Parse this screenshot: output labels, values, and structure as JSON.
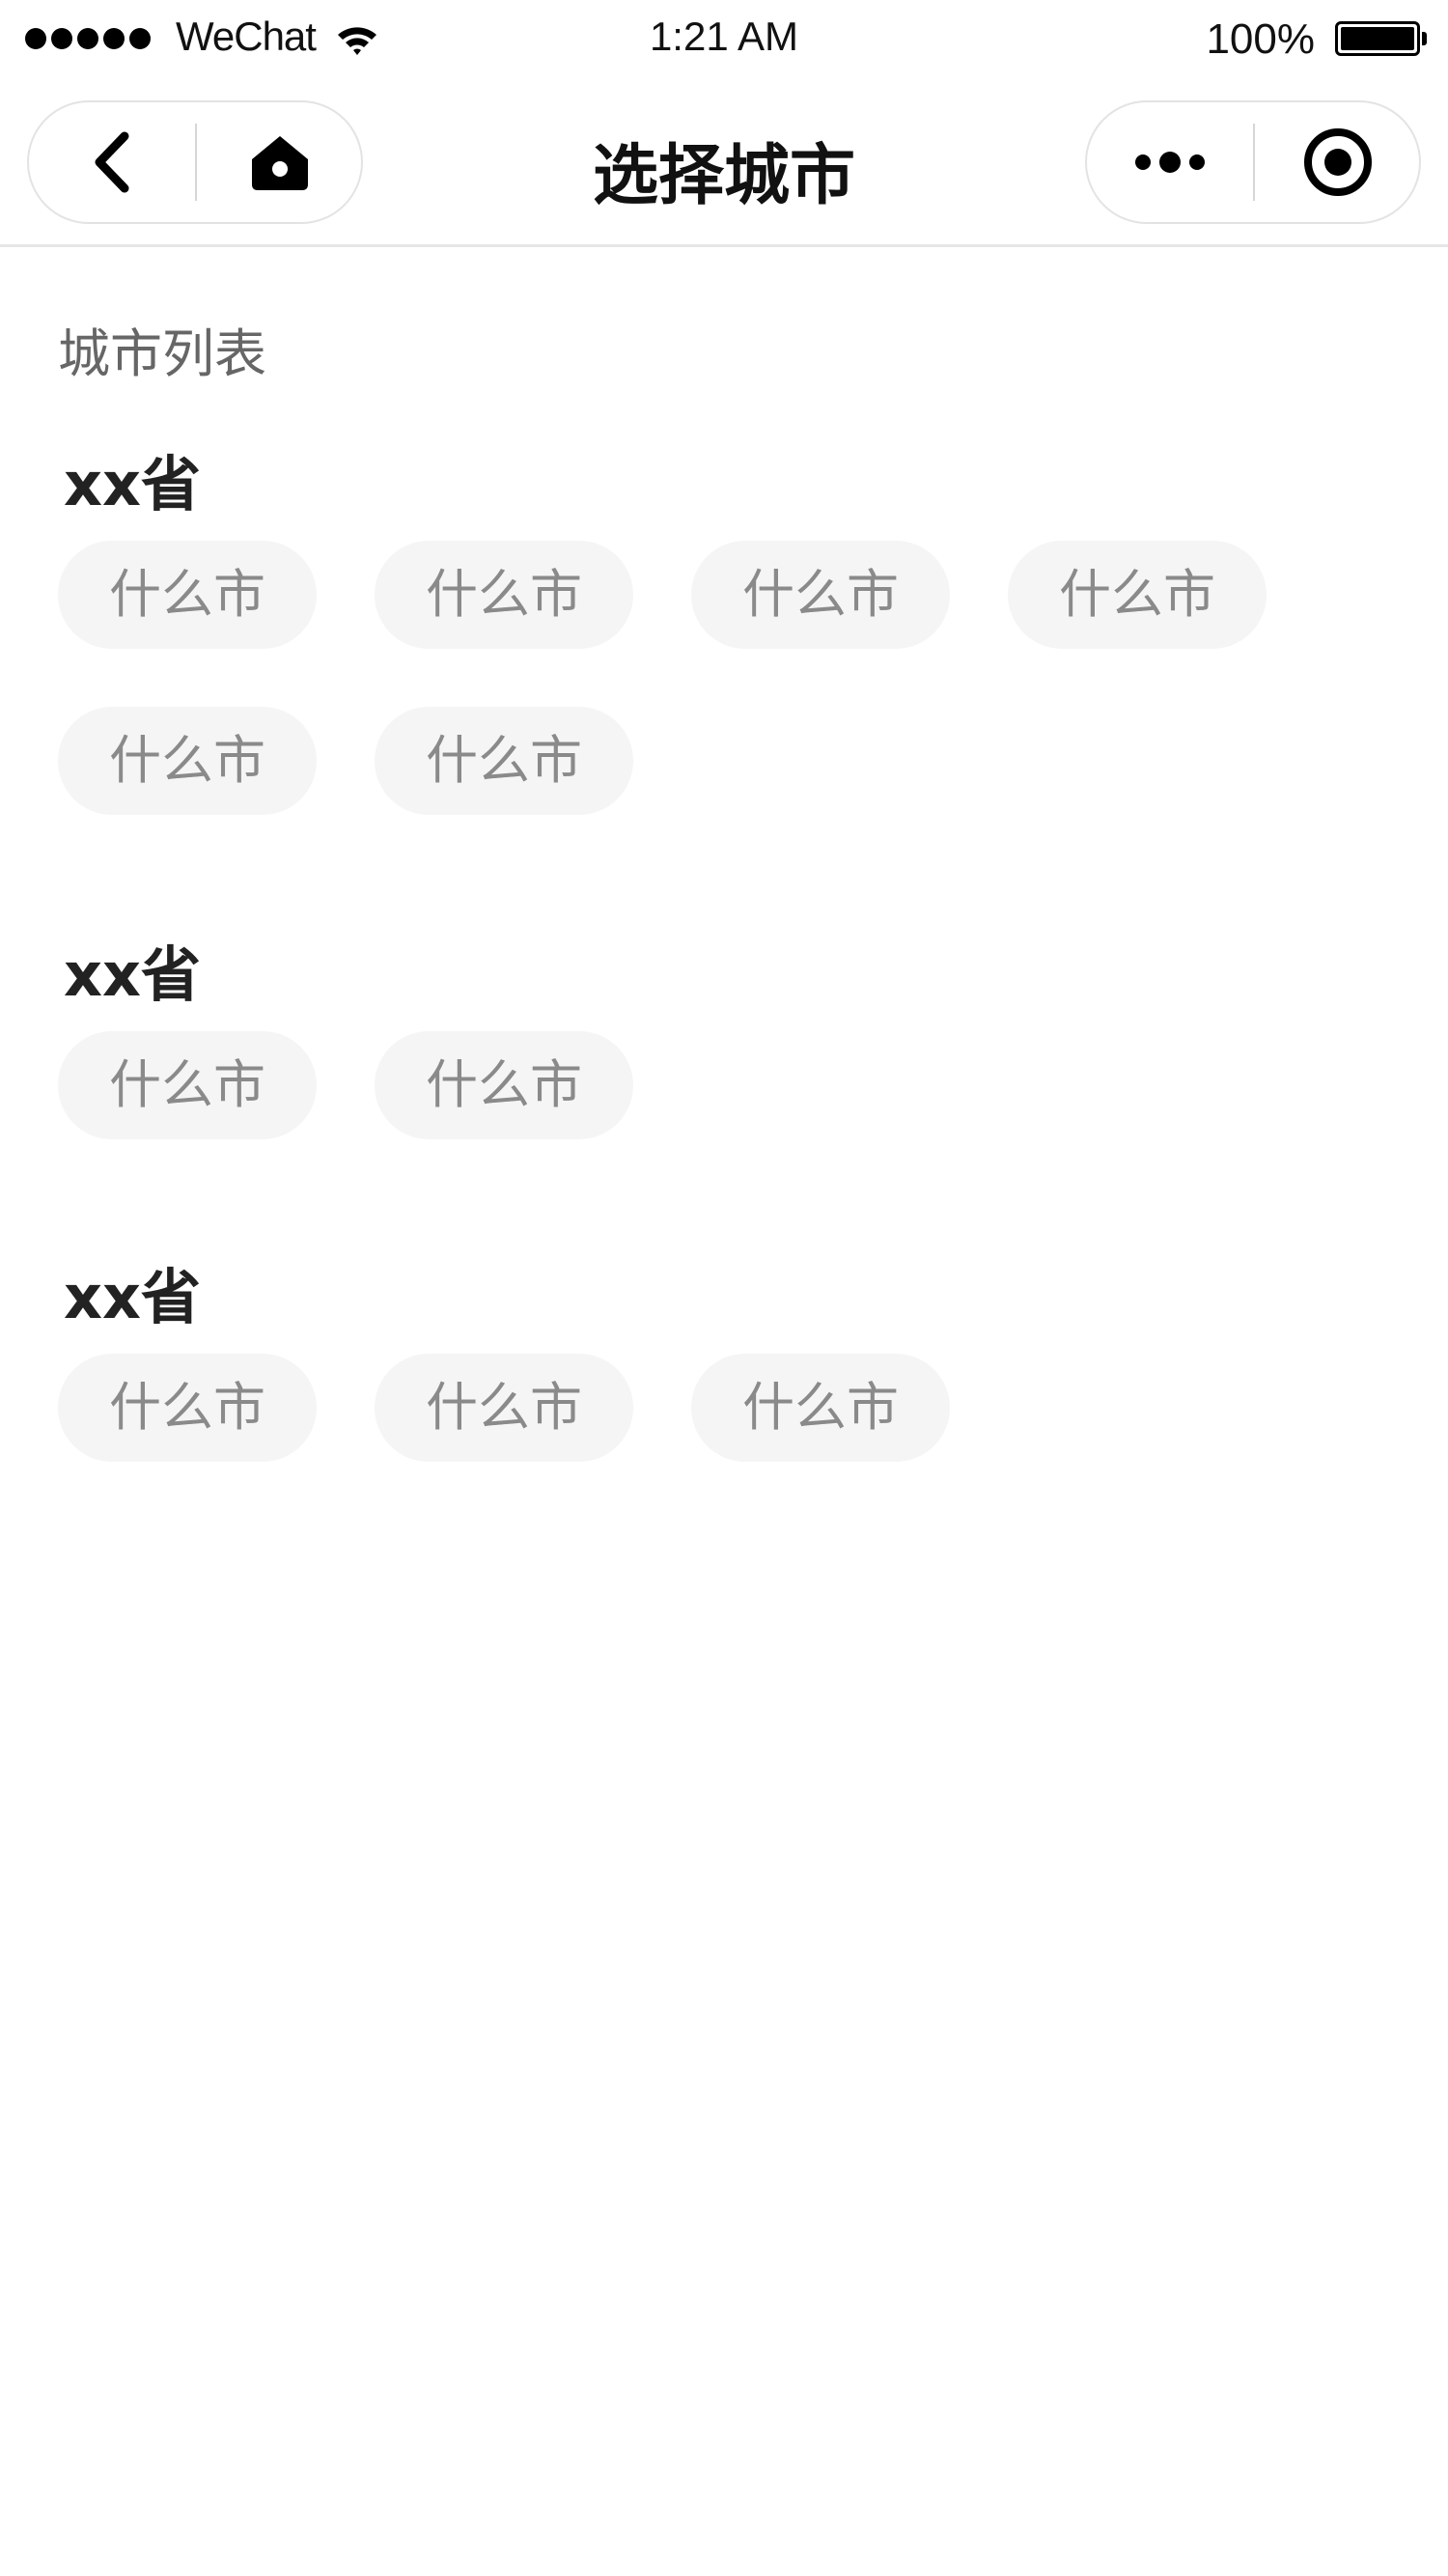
{
  "status_bar": {
    "carrier": "WeChat",
    "time": "1:21 AM",
    "battery_percent": "100%"
  },
  "nav": {
    "title": "选择城市",
    "back_icon": "chevron-left-icon",
    "home_icon": "home-icon",
    "more_icon": "more-dots-icon",
    "close_icon": "target-circle-icon"
  },
  "content": {
    "list_heading": "城市列表",
    "provinces": [
      {
        "name": "xx省",
        "cities": [
          "什么市",
          "什么市",
          "什么市",
          "什么市",
          "什么市",
          "什么市"
        ]
      },
      {
        "name": "xx省",
        "cities": [
          "什么市",
          "什么市"
        ]
      },
      {
        "name": "xx省",
        "cities": [
          "什么市",
          "什么市",
          "什么市"
        ]
      }
    ]
  }
}
